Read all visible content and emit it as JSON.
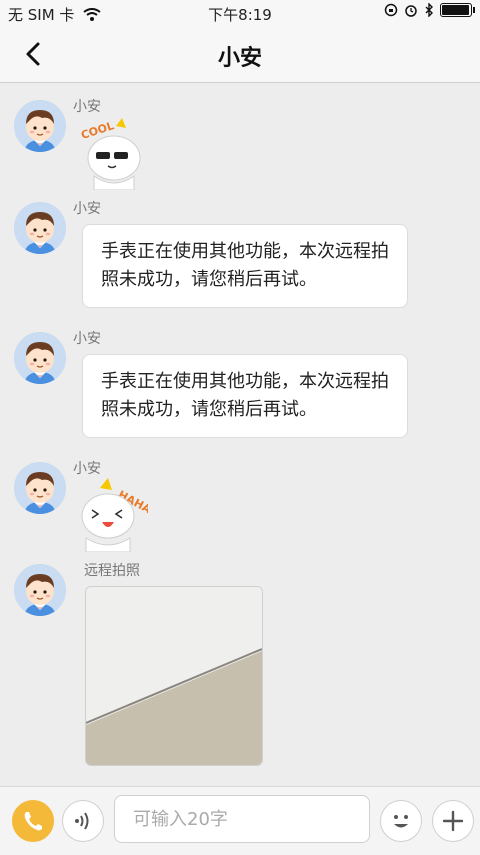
{
  "status_bar": {
    "carrier": "无 SIM 卡",
    "time": "下午8:19",
    "battery_level": 0.9
  },
  "header": {
    "title": "小安",
    "back_icon": "chevron-left-icon"
  },
  "messages": [
    {
      "sender": "小安",
      "type": "sticker",
      "sticker_text": "COOL"
    },
    {
      "sender": "小安",
      "type": "text",
      "text": "手表正在使用其他功能，本次远程拍照未成功，请您稍后再试。"
    },
    {
      "sender": "小安",
      "type": "text",
      "text": "手表正在使用其他功能，本次远程拍照未成功，请您稍后再试。"
    },
    {
      "sender": "小安",
      "type": "sticker",
      "sticker_text": "HAHA"
    },
    {
      "sender": "远程拍照",
      "type": "photo"
    }
  ],
  "input_bar": {
    "placeholder": "可输入20字",
    "phone_icon": "phone-icon",
    "voice_icon": "voice-icon",
    "emoji_icon": "emoji-icon",
    "plus_icon": "plus-icon"
  },
  "colors": {
    "background": "#ededed",
    "accent": "#f5b93a",
    "bubble": "#ffffff"
  }
}
